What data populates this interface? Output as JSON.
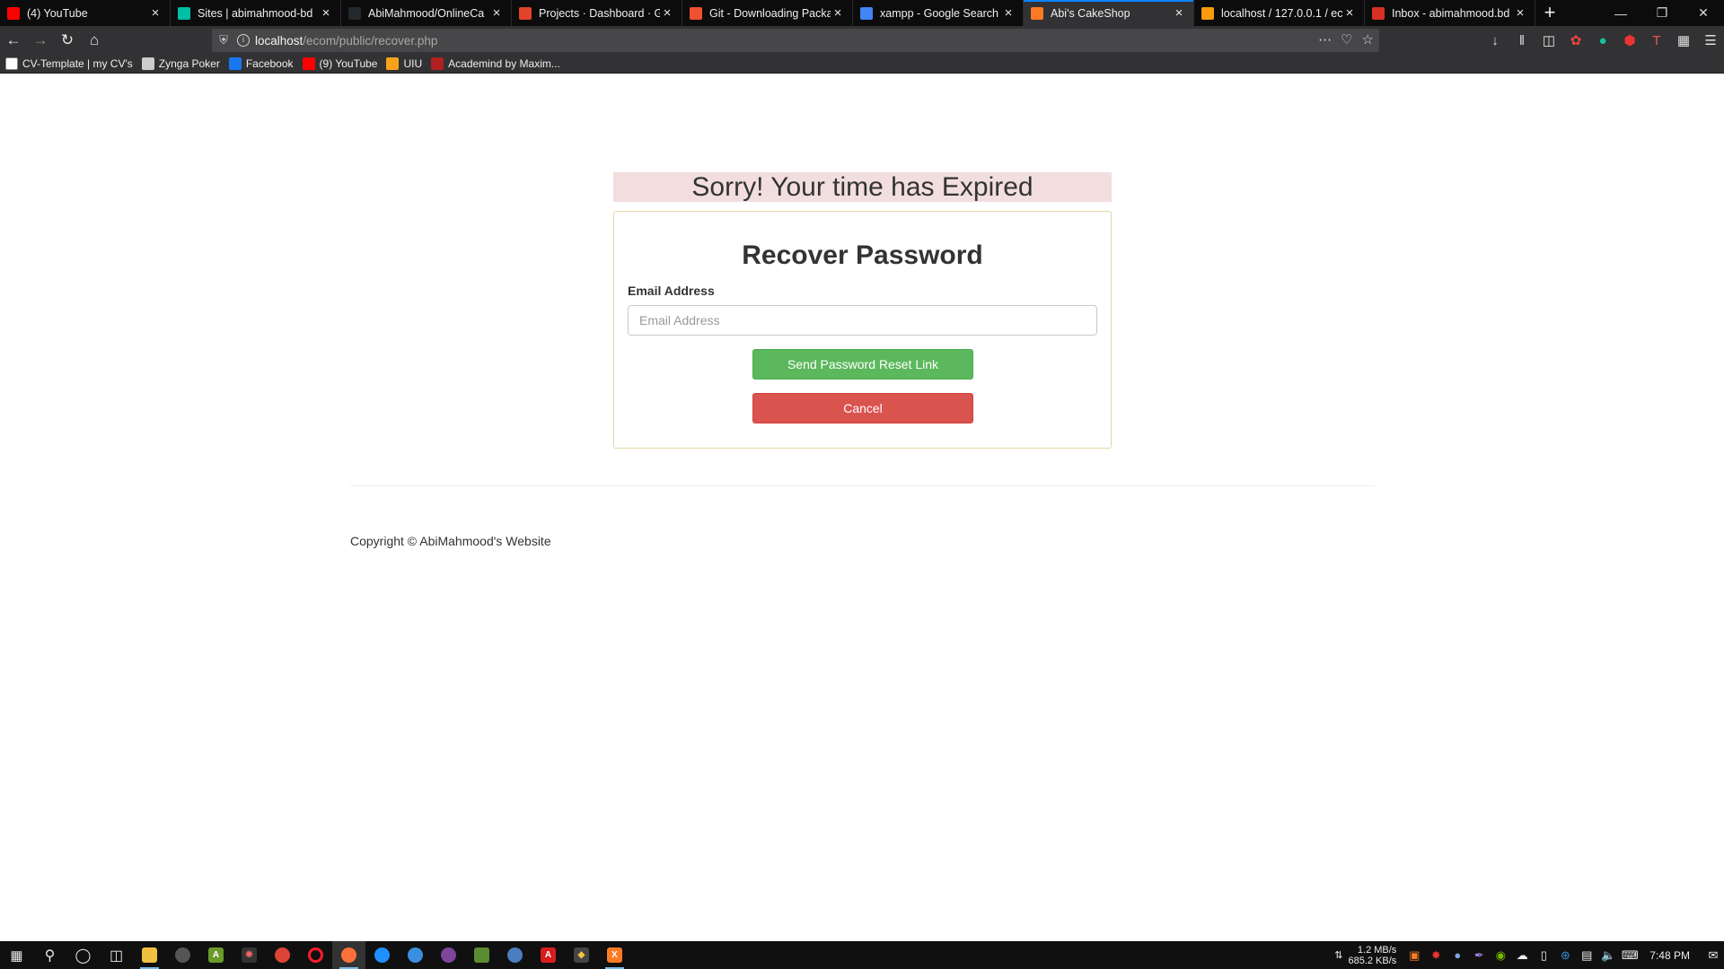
{
  "browser": {
    "tabs": [
      {
        "title": "(4) YouTube",
        "icon": "youtube-icon",
        "color": "#ff0000"
      },
      {
        "title": "Sites | abimahmood-bd",
        "icon": "sites-icon",
        "color": "#00bfa5"
      },
      {
        "title": "AbiMahmood/OnlineCa",
        "icon": "github-icon",
        "color": "#24292e"
      },
      {
        "title": "Projects · Dashboard · Gi",
        "icon": "gitlab-icon",
        "color": "#e24329"
      },
      {
        "title": "Git - Downloading Packa",
        "icon": "git-icon",
        "color": "#f05133"
      },
      {
        "title": "xampp - Google Search",
        "icon": "google-icon",
        "color": "#4285f4"
      },
      {
        "title": "Abi's CakeShop",
        "icon": "xampp-icon",
        "color": "#fb7a24"
      },
      {
        "title": "localhost / 127.0.0.1 / ec",
        "icon": "phpmyadmin-icon",
        "color": "#f89c0e"
      },
      {
        "title": "Inbox - abimahmood.bd",
        "icon": "gmail-icon",
        "color": "#d93025"
      }
    ],
    "active_tab_index": 6,
    "new_tab_symbol": "+",
    "url_host": "localhost",
    "url_path": "/ecom/public/recover.php",
    "bookmarks": [
      {
        "label": "CV-Template | my CV's",
        "icon": "cv-icon",
        "color": "#ffffff"
      },
      {
        "label": "Zynga Poker",
        "icon": "globe-icon",
        "color": "#cccccc"
      },
      {
        "label": "Facebook",
        "icon": "facebook-icon",
        "color": "#1877f2"
      },
      {
        "label": "(9) YouTube",
        "icon": "youtube-icon",
        "color": "#ff0000"
      },
      {
        "label": "UIU",
        "icon": "uiu-icon",
        "color": "#f7a21b"
      },
      {
        "label": "Academind by Maxim...",
        "icon": "academind-icon",
        "color": "#b02020"
      }
    ]
  },
  "page": {
    "alert": "Sorry! Your time has Expired",
    "heading": "Recover Password",
    "email_label": "Email Address",
    "email_placeholder": "Email Address",
    "email_value": "",
    "send_button": "Send Password Reset Link",
    "cancel_button": "Cancel",
    "footer": "Copyright © AbiMahmood's Website",
    "colors": {
      "alert_bg": "#f2dede",
      "success": "#5cb85c",
      "danger": "#d9534f"
    }
  },
  "taskbar": {
    "net_down": "1.2 MB/s",
    "net_up": "685.2 KB/s",
    "clock": "7:48 PM"
  }
}
